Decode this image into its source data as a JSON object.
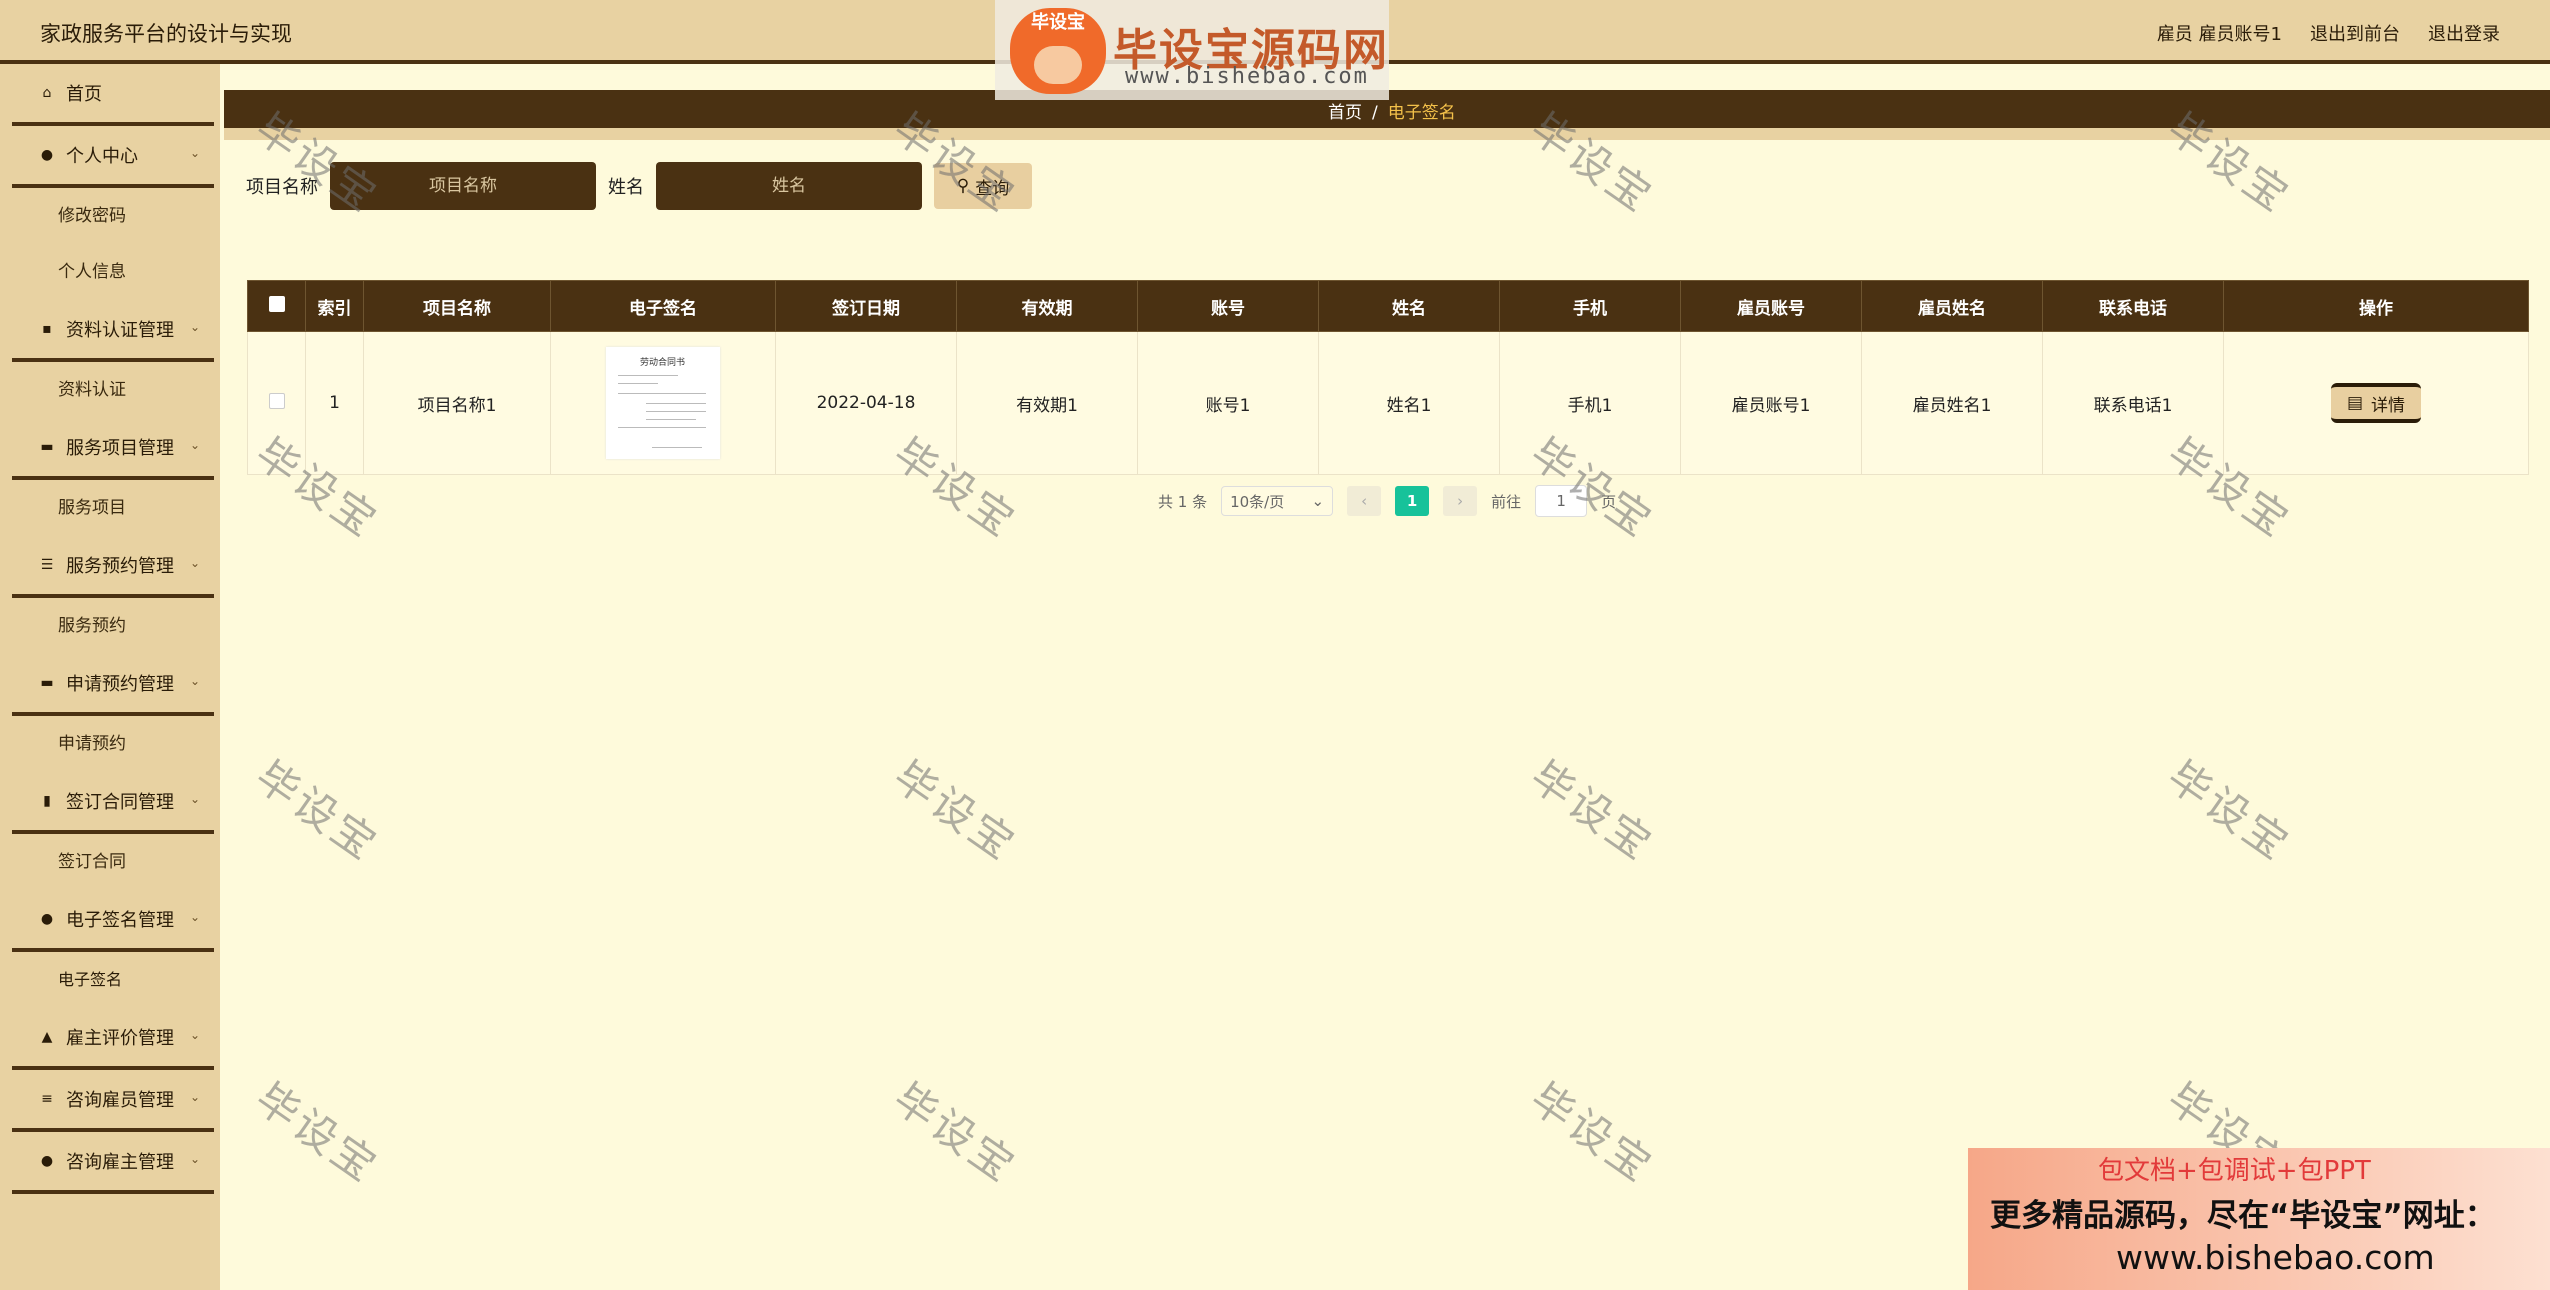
{
  "app_title": "家政服务平台的设计与实现",
  "top_right": {
    "user": "雇员 雇员账号1",
    "front": "退出到前台",
    "logout": "退出登录"
  },
  "sidebar": {
    "home": "首页",
    "groups": [
      {
        "label": "个人中心",
        "icon": "user-icon",
        "items": [
          "修改密码",
          "个人信息"
        ]
      },
      {
        "label": "资料认证管理",
        "icon": "id-card-icon",
        "items": [
          "资料认证"
        ]
      },
      {
        "label": "服务项目管理",
        "icon": "chat-icon",
        "items": [
          "服务项目"
        ]
      },
      {
        "label": "服务预约管理",
        "icon": "sliders-icon",
        "items": [
          "服务预约"
        ]
      },
      {
        "label": "申请预约管理",
        "icon": "monitor-icon",
        "items": [
          "申请预约"
        ]
      },
      {
        "label": "签订合同管理",
        "icon": "chart-icon",
        "items": [
          "签订合同"
        ]
      },
      {
        "label": "电子签名管理",
        "icon": "bulb-icon",
        "items": [
          "电子签名"
        ]
      },
      {
        "label": "雇主评价管理",
        "icon": "thumb-icon",
        "items": []
      },
      {
        "label": "咨询雇员管理",
        "icon": "list-icon",
        "items": []
      },
      {
        "label": "咨询雇主管理",
        "icon": "user-icon",
        "items": []
      }
    ]
  },
  "breadcrumb": {
    "home": "首页",
    "sep": "/",
    "current": "电子签名"
  },
  "search": {
    "project_label": "项目名称",
    "project_placeholder": "项目名称",
    "name_label": "姓名",
    "name_placeholder": "姓名",
    "query_button": "查询"
  },
  "table": {
    "headers": [
      "索引",
      "项目名称",
      "电子签名",
      "签订日期",
      "有效期",
      "账号",
      "姓名",
      "手机",
      "雇员账号",
      "雇员姓名",
      "联系电话",
      "操作"
    ],
    "rows": [
      {
        "index": "1",
        "project": "项目名称1",
        "signature_image_title": "劳动合同书",
        "date": "2022-04-18",
        "valid": "有效期1",
        "account": "账号1",
        "name": "姓名1",
        "phone": "手机1",
        "emp_account": "雇员账号1",
        "emp_name": "雇员姓名1",
        "contact": "联系电话1",
        "action": "详情"
      }
    ]
  },
  "pagination": {
    "total": "共 1 条",
    "page_size": "10条/页",
    "current_page": "1",
    "goto_prefix": "前往",
    "goto_value": "1",
    "goto_suffix": "页"
  },
  "watermark_text": "毕设宝",
  "logo": {
    "badge": "毕设宝",
    "name": "毕设宝源码网",
    "url": "www.bishebao.com"
  },
  "promo": {
    "line1": "包文档+包调试+包PPT",
    "line2": "更多精品源码，尽在“毕设宝”网址：",
    "line3": "www.bishebao.com"
  },
  "colors": {
    "dark_brown": "#4a3112",
    "tan": "#e8d2a2",
    "cream": "#fefadb",
    "page_active": "#17c29a",
    "breadcrumb_current": "#f4c14a"
  }
}
